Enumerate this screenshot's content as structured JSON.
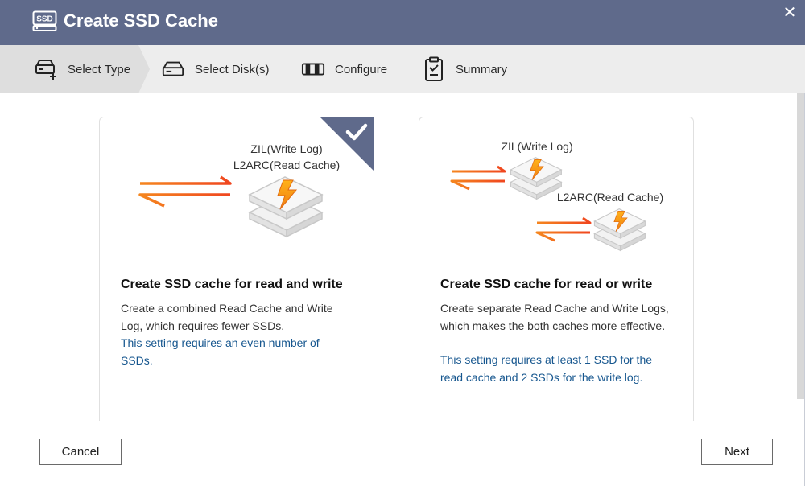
{
  "window": {
    "title": "Create SSD Cache",
    "title_icon": "ssd-icon",
    "title_icon_text": "SSD",
    "close_glyph": "✕",
    "colors": {
      "titlebar": "#5f6a8b",
      "accent": "#5f6a8b",
      "note": "#17578f",
      "orange": "#f7931e"
    }
  },
  "steps": [
    {
      "label": "Select Type",
      "icon": "ssd-add-icon",
      "active": true
    },
    {
      "label": "Select Disk(s)",
      "icon": "disk-icon",
      "active": false
    },
    {
      "label": "Configure",
      "icon": "configure-icon",
      "active": false
    },
    {
      "label": "Summary",
      "icon": "clipboard-check-icon",
      "active": false
    }
  ],
  "cards": [
    {
      "selected": true,
      "diagram_labels": [
        "ZIL(Write Log)",
        "L2ARC(Read Cache)"
      ],
      "title": "Create SSD cache for read and write",
      "description": "Create a combined Read Cache and Write Log, which requires fewer SSDs.",
      "note": "This setting requires an even number of SSDs."
    },
    {
      "selected": false,
      "diagram_labels": [
        "ZIL(Write Log)",
        "L2ARC(Read Cache)"
      ],
      "title": "Create SSD cache for read or write",
      "description": "Create separate Read Cache and Write Logs, which makes the both caches more effective.",
      "note": "This setting requires at least 1 SSD for the read cache and 2 SSDs for the write log."
    }
  ],
  "buttons": {
    "cancel": "Cancel",
    "next": "Next"
  }
}
